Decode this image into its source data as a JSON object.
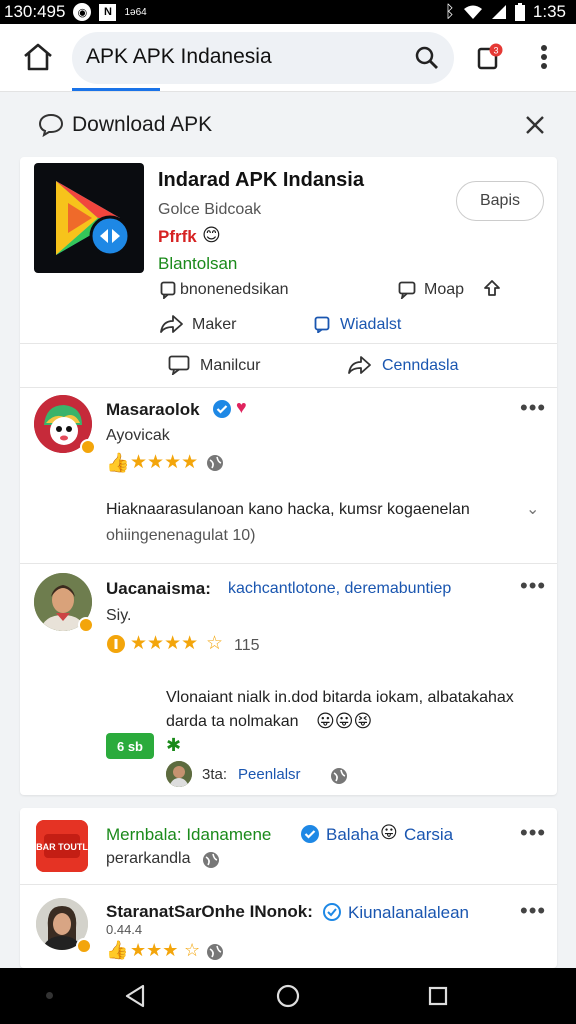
{
  "status_bar": {
    "time_left": "130:495",
    "badge_n": "N",
    "small_text": "1ǝ64",
    "time_right": "1:35"
  },
  "browser": {
    "url": "APK APK Indanesia"
  },
  "banner": {
    "title": "Download APK"
  },
  "app": {
    "name": "Indarad APK Indansia",
    "developer": "Golce Bidcoak",
    "rating_text": "Pfrfk",
    "status": "Blantolsan",
    "button": "Bapis",
    "action_left": "bnonenedsikan",
    "action_right": "Moap",
    "action_maker": "Maker",
    "action_link": "Wiadalst",
    "footer_left": "Manilcur",
    "footer_right": "Cenndasla"
  },
  "reviews": [
    {
      "name": "Masaraolok",
      "sub": "Ayovicak",
      "text_line1": "Hiaknaarasulanoan kano hacka, kumsr kogaenelan",
      "text_line2": "ohiingenenagulat 10)"
    },
    {
      "name": "Uacanaisma:",
      "name_link": "kachcantlotone, deremabuntiep",
      "sub": "Siy.",
      "rating_count": "115",
      "text_line1": "Vlonaiant nialk in.dod bitarda iokam, albatakahax",
      "text_line2": "darda ta nolmakan",
      "chip": "6 sb",
      "reply_label": "3ta:",
      "reply_link": "Peenlalsr"
    },
    {
      "name": "Mernbala: Idanamene",
      "name_link": "Balaha",
      "name_tail": "Carsia",
      "sub": "perarkandla",
      "logo_text": "BAR TOUTL"
    },
    {
      "name": "StaranatSarOnhe INonok:",
      "name_link": "Kiunalanalalean",
      "sub": "0.44.4"
    }
  ],
  "colors": {
    "accent_blue": "#1a73e8",
    "link_blue": "#1a56b0",
    "green": "#1a8a1a",
    "star": "#f3a50b"
  }
}
